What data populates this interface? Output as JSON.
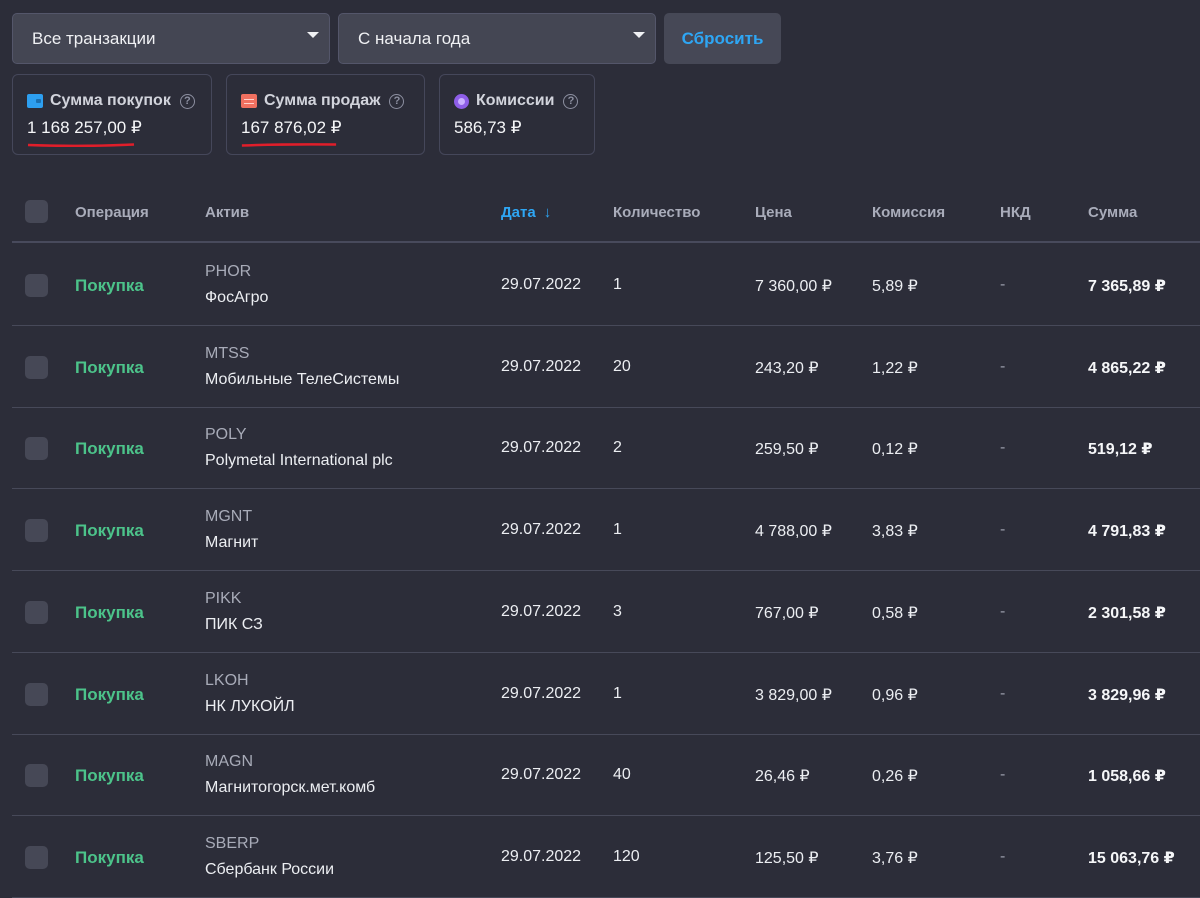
{
  "filters": {
    "transactions": "Все транзакции",
    "period": "С начала года",
    "reset_label": "Сбросить"
  },
  "cards": [
    {
      "label": "Сумма покупок",
      "value": "1 168 257,00 ₽",
      "icon": "wallet-icon",
      "color": "#2d9ff0"
    },
    {
      "label": "Сумма продаж",
      "value": "167 876,02 ₽",
      "icon": "cash-icon",
      "color": "#f07060"
    },
    {
      "label": "Комиссии",
      "value": "586,73 ₽",
      "icon": "coin-icon",
      "color": "#8e5ee8"
    }
  ],
  "help_glyph": "?",
  "table": {
    "columns": [
      "Операция",
      "Актив",
      "Дата",
      "Количество",
      "Цена",
      "Комиссия",
      "НКД",
      "Сумма"
    ],
    "sort_arrow": "↓",
    "rows": [
      {
        "op": "Покупка",
        "ticker": "PHOR",
        "name": "ФосАгро",
        "date": "29.07.2022",
        "qty": "1",
        "price": "7 360,00 ₽",
        "fee": "5,89 ₽",
        "nkd": "-",
        "sum": "7 365,89 ₽"
      },
      {
        "op": "Покупка",
        "ticker": "MTSS",
        "name": "Мобильные ТелеСистемы",
        "date": "29.07.2022",
        "qty": "20",
        "price": "243,20 ₽",
        "fee": "1,22 ₽",
        "nkd": "-",
        "sum": "4 865,22 ₽"
      },
      {
        "op": "Покупка",
        "ticker": "POLY",
        "name": "Polymetal International plc",
        "date": "29.07.2022",
        "qty": "2",
        "price": "259,50 ₽",
        "fee": "0,12 ₽",
        "nkd": "-",
        "sum": "519,12 ₽"
      },
      {
        "op": "Покупка",
        "ticker": "MGNT",
        "name": "Магнит",
        "date": "29.07.2022",
        "qty": "1",
        "price": "4 788,00 ₽",
        "fee": "3,83 ₽",
        "nkd": "-",
        "sum": "4 791,83 ₽"
      },
      {
        "op": "Покупка",
        "ticker": "PIKK",
        "name": "ПИК СЗ",
        "date": "29.07.2022",
        "qty": "3",
        "price": "767,00 ₽",
        "fee": "0,58 ₽",
        "nkd": "-",
        "sum": "2 301,58 ₽"
      },
      {
        "op": "Покупка",
        "ticker": "LKOH",
        "name": "НК ЛУКОЙЛ",
        "date": "29.07.2022",
        "qty": "1",
        "price": "3 829,00 ₽",
        "fee": "0,96 ₽",
        "nkd": "-",
        "sum": "3 829,96 ₽"
      },
      {
        "op": "Покупка",
        "ticker": "MAGN",
        "name": "Магнитогорск.мет.комб",
        "date": "29.07.2022",
        "qty": "40",
        "price": "26,46 ₽",
        "fee": "0,26 ₽",
        "nkd": "-",
        "sum": "1 058,66 ₽"
      },
      {
        "op": "Покупка",
        "ticker": "SBERP",
        "name": "Сбербанк России",
        "date": "29.07.2022",
        "qty": "120",
        "price": "125,50 ₽",
        "fee": "3,76 ₽",
        "nkd": "-",
        "sum": "15 063,76 ₽"
      }
    ]
  }
}
